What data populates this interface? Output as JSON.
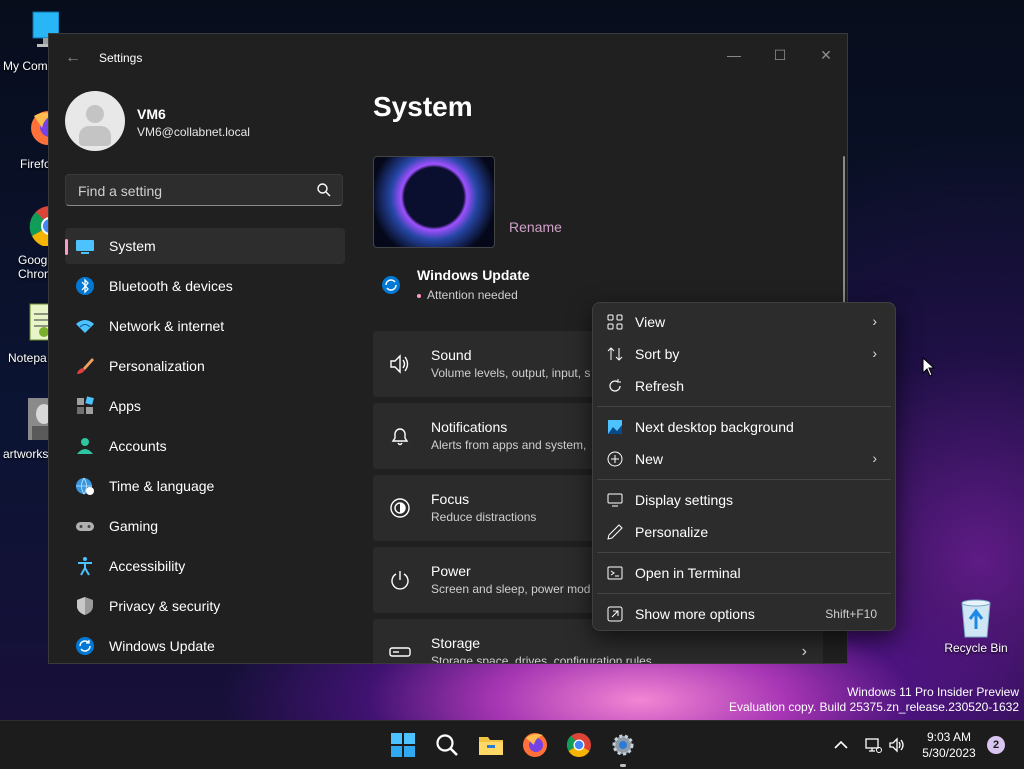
{
  "desktop": {
    "icons": [
      {
        "label": "My Com",
        "icon": "monitor-icon"
      },
      {
        "label": "Firefo",
        "icon": "firefox-icon"
      },
      {
        "label": "Goog\nChron",
        "icon": "chrome-icon"
      },
      {
        "label": "Notepa",
        "icon": "notepad-icon"
      },
      {
        "label": "artworks",
        "icon": "image-file-icon"
      }
    ],
    "recycle_bin": "Recycle Bin"
  },
  "window": {
    "app_title": "Settings",
    "back_icon": "back-arrow-icon",
    "controls": {
      "minimize": "—",
      "maximize": "☐",
      "close": "✕"
    },
    "user": {
      "name": "VM6",
      "email": "VM6@collabnet.local"
    },
    "search": {
      "placeholder": "Find a setting",
      "value": ""
    },
    "nav": [
      {
        "label": "System",
        "icon": "system-display-icon",
        "active": true
      },
      {
        "label": "Bluetooth & devices",
        "icon": "bluetooth-icon"
      },
      {
        "label": "Network & internet",
        "icon": "wifi-icon"
      },
      {
        "label": "Personalization",
        "icon": "brush-icon"
      },
      {
        "label": "Apps",
        "icon": "apps-icon"
      },
      {
        "label": "Accounts",
        "icon": "account-icon"
      },
      {
        "label": "Time & language",
        "icon": "globe-clock-icon"
      },
      {
        "label": "Gaming",
        "icon": "gamepad-icon"
      },
      {
        "label": "Accessibility",
        "icon": "accessibility-icon"
      },
      {
        "label": "Privacy & security",
        "icon": "shield-icon"
      },
      {
        "label": "Windows Update",
        "icon": "update-icon"
      }
    ],
    "page_title": "System",
    "rename_link": "Rename",
    "windows_update": {
      "title": "Windows Update",
      "status": "Attention needed"
    },
    "cards": [
      {
        "title": "Sound",
        "subtitle": "Volume levels, output, input, s",
        "icon": "speaker-icon"
      },
      {
        "title": "Notifications",
        "subtitle": "Alerts from apps and system,",
        "icon": "bell-icon"
      },
      {
        "title": "Focus",
        "subtitle": "Reduce distractions",
        "icon": "focus-icon"
      },
      {
        "title": "Power",
        "subtitle": "Screen and sleep, power mod",
        "icon": "power-icon"
      },
      {
        "title": "Storage",
        "subtitle": "Storage space, drives, configuration rules",
        "icon": "storage-icon",
        "chevron": "›"
      }
    ]
  },
  "context_menu": {
    "items": [
      {
        "label": "View",
        "icon": "grid-view-icon",
        "submenu": "›"
      },
      {
        "label": "Sort by",
        "icon": "sort-icon",
        "submenu": "›"
      },
      {
        "label": "Refresh",
        "icon": "refresh-icon"
      },
      {
        "label": "Next desktop background",
        "icon": "next-background-icon"
      },
      {
        "label": "New",
        "icon": "new-plus-icon",
        "submenu": "›"
      },
      {
        "label": "Display settings",
        "icon": "display-settings-icon"
      },
      {
        "label": "Personalize",
        "icon": "pen-icon"
      },
      {
        "label": "Open in Terminal",
        "icon": "terminal-icon"
      },
      {
        "label": "Show more options",
        "icon": "more-options-icon",
        "shortcut": "Shift+F10"
      }
    ]
  },
  "watermark": {
    "line1": "Windows 11 Pro Insider Preview",
    "line2": "Evaluation copy. Build 25375.zn_release.230520-1632"
  },
  "taskbar": {
    "apps": [
      "start-icon",
      "search-icon",
      "file-explorer-icon",
      "firefox-icon",
      "chrome-icon",
      "settings-gear-icon"
    ],
    "time": "9:03 AM",
    "date": "5/30/2023",
    "notification_count": "2"
  },
  "colors": {
    "accent": "#ff99cc",
    "window_bg": "#202020",
    "card_bg": "#2b2b2b",
    "menu_bg": "#2c2c2c"
  }
}
